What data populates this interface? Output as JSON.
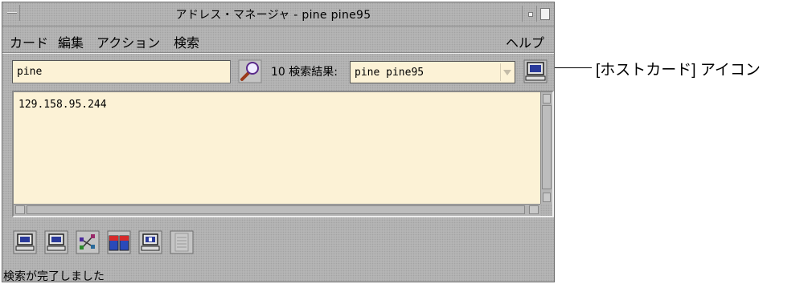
{
  "window": {
    "title": "アドレス・マネージャ - pine pine95"
  },
  "menu": {
    "items": [
      "カード",
      "編集",
      "アクション",
      "検索"
    ],
    "help": "ヘルプ"
  },
  "search": {
    "value": "pine",
    "count": "10",
    "results_label": "検索結果:",
    "results_value": "pine pine95"
  },
  "content": {
    "text": "129.158.95.244"
  },
  "toolbar": {
    "icons": [
      "host-computer-icon",
      "host-computer-icon",
      "network-map-icon",
      "tile-panels-icon",
      "help-computer-icon",
      "list-icon"
    ]
  },
  "status": {
    "text": "検索が完了しました"
  },
  "callout": {
    "label": "[ホストカード] アイコン"
  },
  "colors": {
    "window_bg": "#b5b5b5",
    "field_bg": "#fcf2d6"
  }
}
